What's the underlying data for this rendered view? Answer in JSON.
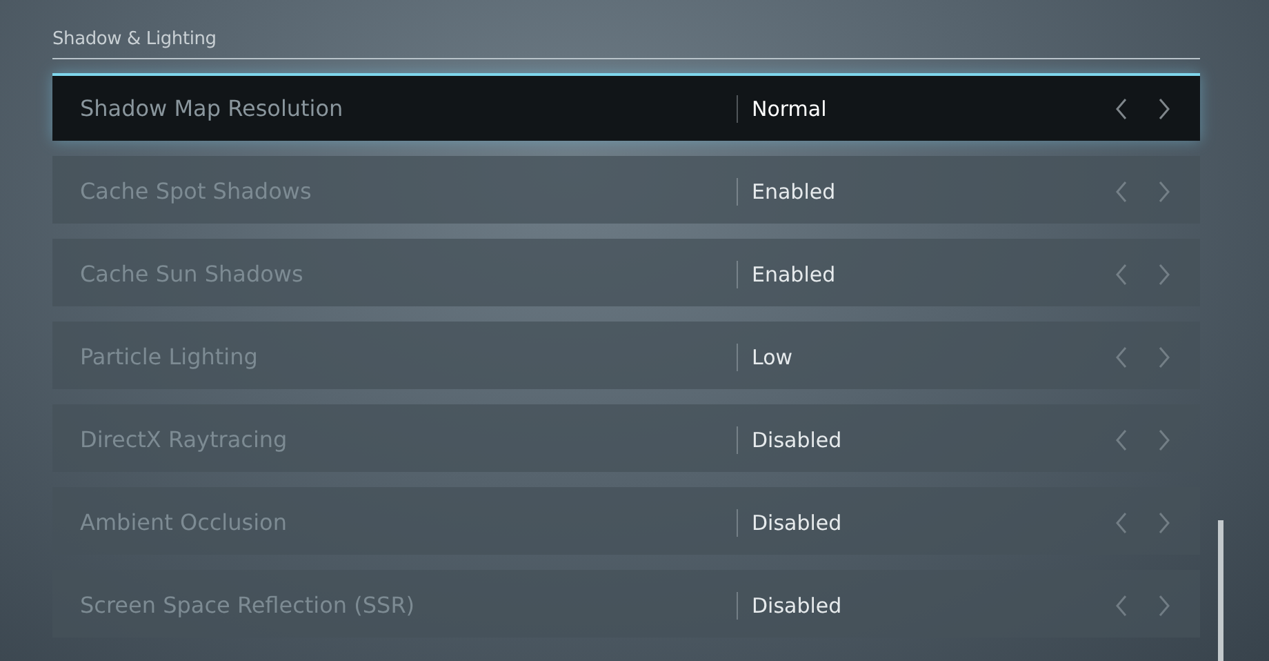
{
  "section": {
    "title": "Shadow & Lighting"
  },
  "settings": [
    {
      "label": "Shadow Map Resolution",
      "value": "Normal",
      "selected": true
    },
    {
      "label": "Cache Spot Shadows",
      "value": "Enabled",
      "selected": false
    },
    {
      "label": "Cache Sun Shadows",
      "value": "Enabled",
      "selected": false
    },
    {
      "label": "Particle Lighting",
      "value": "Low",
      "selected": false
    },
    {
      "label": "DirectX Raytracing",
      "value": "Disabled",
      "selected": false
    },
    {
      "label": "Ambient Occlusion",
      "value": "Disabled",
      "selected": false
    },
    {
      "label": "Screen Space Reflection (SSR)",
      "value": "Disabled",
      "selected": false
    }
  ]
}
